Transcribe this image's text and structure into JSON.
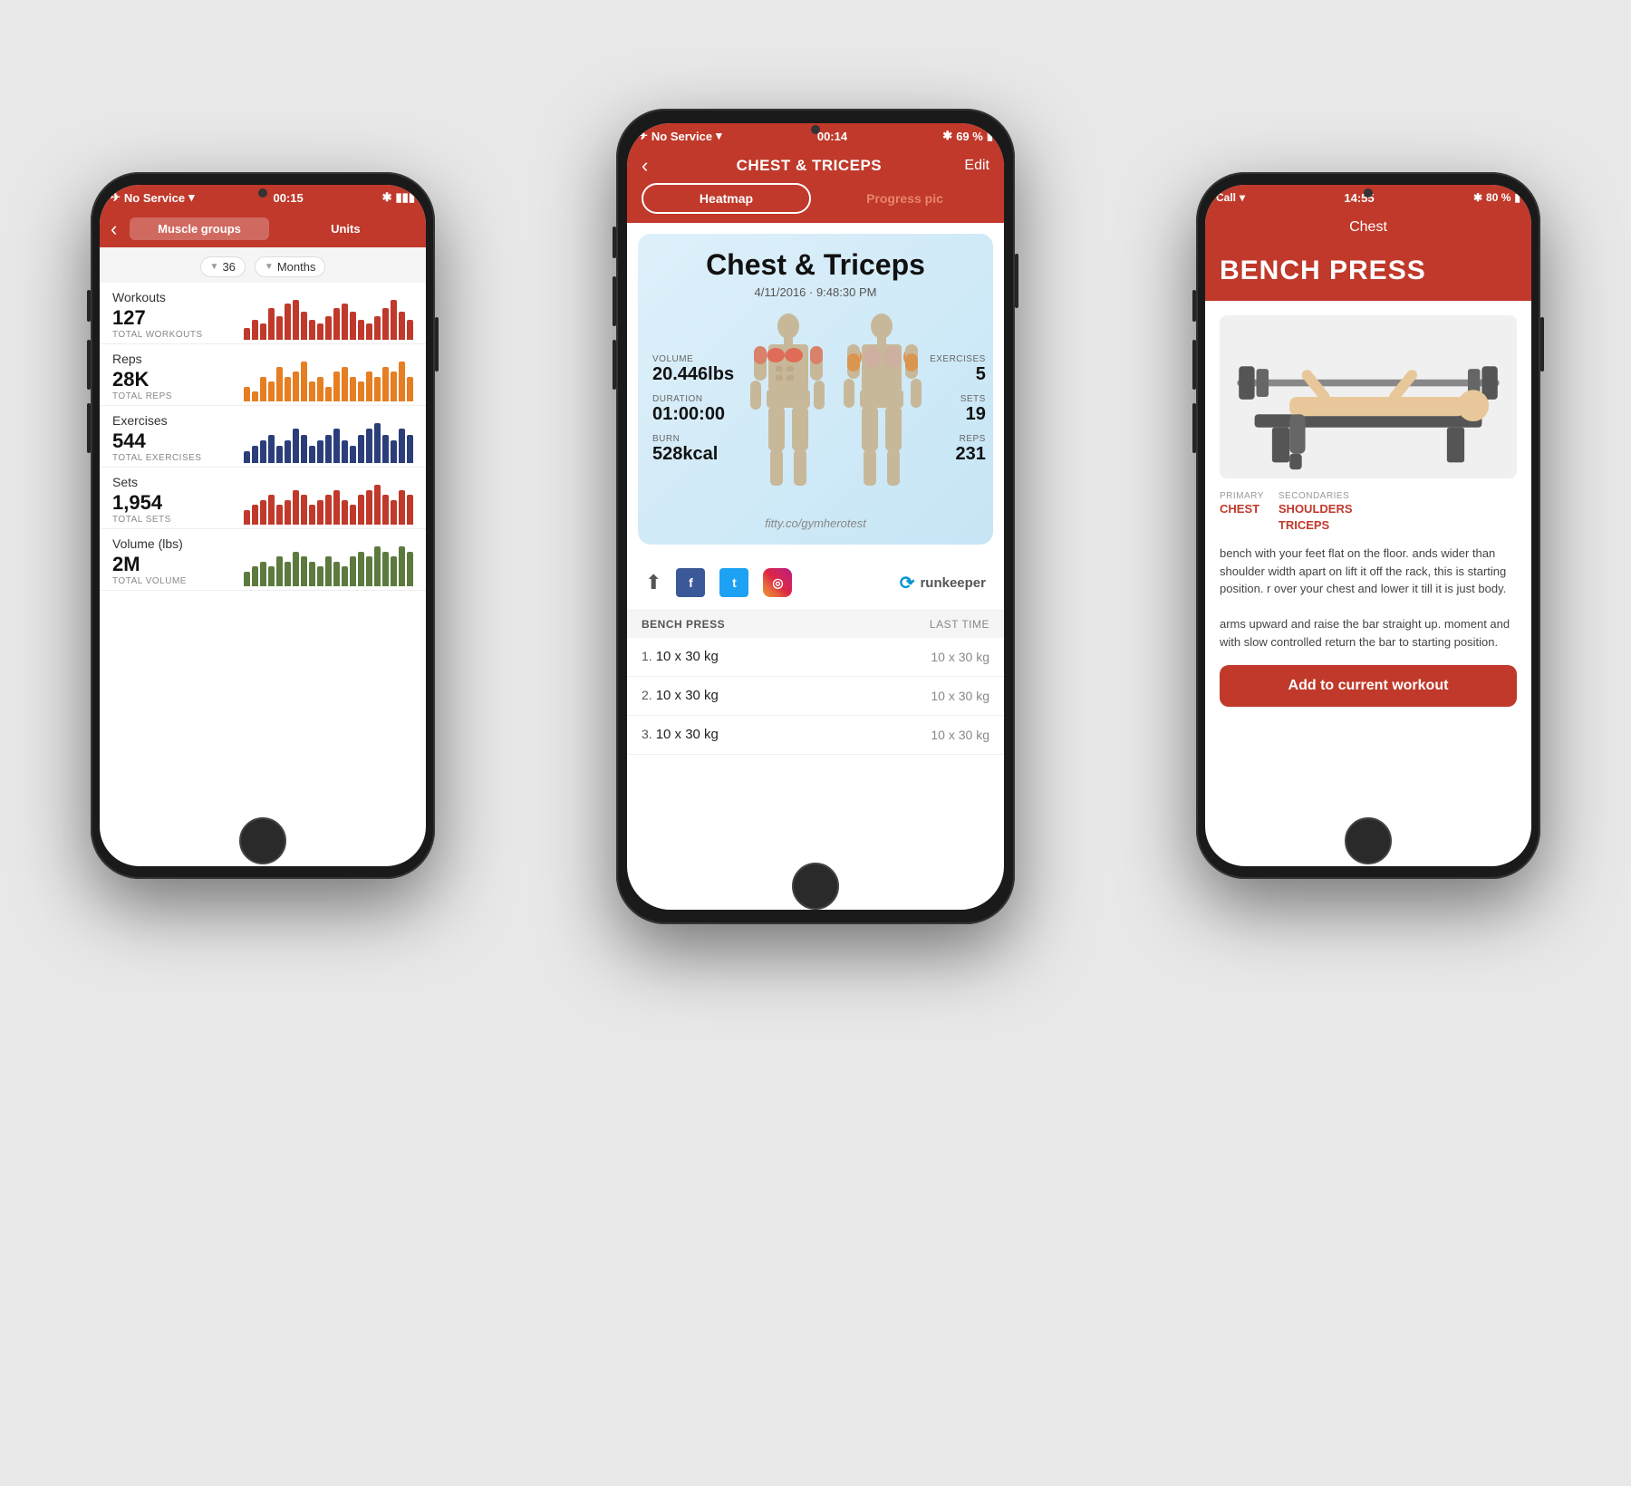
{
  "phones": {
    "left": {
      "status": {
        "service": "No Service",
        "time": "00:15",
        "bluetooth": "✱",
        "battery": "🔋"
      },
      "nav": {
        "back": "‹",
        "tabs": [
          "Muscle groups",
          "Units"
        ]
      },
      "filter": {
        "count": "36",
        "period": "Months"
      },
      "stats": [
        {
          "section": "Workouts",
          "value": "127",
          "sub": "TOTAL WORKOUTS",
          "color": "#c0392b",
          "bars": [
            3,
            5,
            4,
            8,
            6,
            9,
            10,
            7,
            5,
            4,
            6,
            8,
            9,
            7,
            5,
            4,
            6,
            8,
            10,
            7,
            5
          ]
        },
        {
          "section": "Reps",
          "value": "28K",
          "sub": "TOTAL REPS",
          "color": "#e67e22",
          "bars": [
            3,
            2,
            5,
            4,
            7,
            5,
            6,
            8,
            4,
            5,
            3,
            6,
            7,
            5,
            4,
            6,
            5,
            7,
            6,
            8,
            5
          ]
        },
        {
          "section": "Exercises",
          "value": "544",
          "sub": "TOTAL EXERCISES",
          "color": "#2c3e7a",
          "bars": [
            2,
            3,
            4,
            5,
            3,
            4,
            6,
            5,
            3,
            4,
            5,
            6,
            4,
            3,
            5,
            6,
            7,
            5,
            4,
            6,
            5
          ]
        },
        {
          "section": "Sets",
          "value": "1,954",
          "sub": "TOTAL SETS",
          "color": "#c0392b",
          "bars": [
            3,
            4,
            5,
            6,
            4,
            5,
            7,
            6,
            4,
            5,
            6,
            7,
            5,
            4,
            6,
            7,
            8,
            6,
            5,
            7,
            6
          ]
        },
        {
          "section": "Volume (lbs)",
          "value": "2M",
          "sub": "TOTAL VOLUME",
          "color": "#5d7a3e",
          "bars": [
            3,
            4,
            5,
            4,
            6,
            5,
            7,
            6,
            5,
            4,
            6,
            5,
            4,
            6,
            7,
            6,
            8,
            7,
            6,
            8,
            7
          ]
        }
      ]
    },
    "center": {
      "status": {
        "service": "No Service",
        "time": "00:14",
        "bluetooth": "✱",
        "battery": "69 %"
      },
      "nav": {
        "back": "‹",
        "title": "CHEST & TRICEPS",
        "edit": "Edit"
      },
      "tabs": [
        {
          "label": "Heatmap",
          "active": true
        },
        {
          "label": "Progress pic",
          "active": false
        }
      ],
      "workout": {
        "title": "Chest & Triceps",
        "date": "4/11/2016 · 9:48:30 PM",
        "volume_label": "VOLUME",
        "volume_value": "20.446lbs",
        "exercises_label": "EXERCISES",
        "exercises_value": "5",
        "duration_label": "DURATION",
        "duration_value": "01:00:00",
        "sets_label": "SETS",
        "sets_value": "19",
        "burn_label": "BURN",
        "burn_value": "528kcal",
        "reps_label": "REPS",
        "reps_value": "231",
        "website": "fitty.co/gymherotest"
      },
      "share": {
        "icons": [
          "share",
          "facebook",
          "twitter",
          "instagram"
        ],
        "runkeeper": "runkeeper"
      },
      "exercise_list": {
        "title": "BENCH PRESS",
        "last_time_label": "LAST TIME",
        "rows": [
          {
            "num": "1.",
            "set": "10 x 30 kg",
            "last": "10 x 30 kg"
          },
          {
            "num": "2.",
            "set": "10 x 30 kg",
            "last": "10 x 30 kg"
          },
          {
            "num": "3.",
            "set": "10 x 30 kg",
            "last": "10 x 30 kg"
          }
        ]
      }
    },
    "right": {
      "status": {
        "service": "Call",
        "wifi": "▾",
        "time": "14:55",
        "bluetooth": "✱",
        "battery": "80 %"
      },
      "nav": {
        "title": "Chest"
      },
      "exercise": {
        "name": "BENCH PRESS",
        "primary_label": "PRIMARY",
        "primary_muscles": "CHEST",
        "secondaries_label": "SECONDARIES",
        "secondary_muscles": "SHOULDERS\nTRICEPS",
        "description": "bench with your feet flat on the floor. ands wider than shoulder width apart on lift it off the rack, this is starting position. r over your chest and lower it till it is just body.\n\narms upward and raise the bar straight up. moment and with slow controlled return the bar to starting position.",
        "add_button": "Add to current workout"
      }
    }
  },
  "colors": {
    "primary_red": "#c0392b",
    "text_dark": "#111111",
    "text_mid": "#555555",
    "text_light": "#888888"
  }
}
